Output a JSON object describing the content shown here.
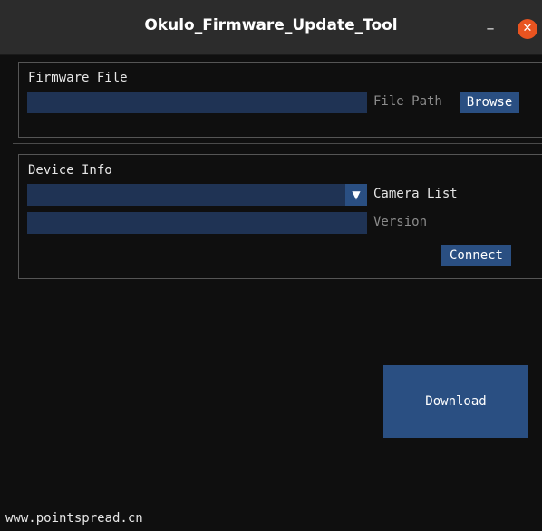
{
  "window": {
    "title": "Okulo_Firmware_Update_Tool",
    "minimize_glyph": "–",
    "close_glyph": "✕"
  },
  "firmware": {
    "section_label": "Firmware File",
    "path_value": "",
    "path_label": "File Path",
    "browse_label": "Browse"
  },
  "device": {
    "section_label": "Device Info",
    "camera_selected": "",
    "dropdown_glyph": "▼",
    "camera_label": "Camera List",
    "version_value": "",
    "version_label": "Version",
    "connect_label": "Connect"
  },
  "download_label": "Download",
  "footer_text": "www.pointspread.cn",
  "colors": {
    "background": "#0f0f0f",
    "field": "#1f3354",
    "button": "#2a4f82",
    "close_button": "#e95420"
  }
}
